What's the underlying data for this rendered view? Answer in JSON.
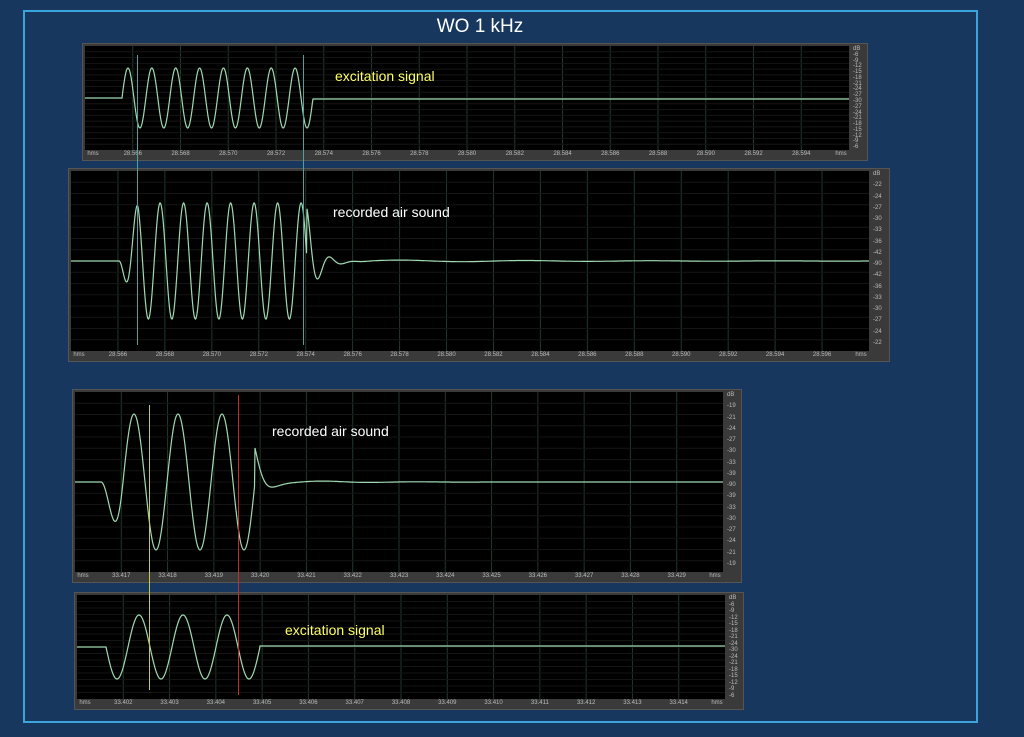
{
  "title": "WO  1 kHz",
  "colors": {
    "background": "#17375e",
    "frame": "#3ba4dc",
    "waveform": "#9fd9b0",
    "excitation_label": "#ffff66",
    "recorded_label": "#ffffff",
    "cursor_green": "#4fa0a0",
    "cursor_yellow": "#c8c84a",
    "cursor_red": "#c03030"
  },
  "panels": [
    {
      "id": "top-excitation",
      "label": "excitation signal",
      "label_color": "#ffff66",
      "y_ticks": [
        "dB",
        "-6",
        "-9",
        "-12",
        "-15",
        "-18",
        "-21",
        "-24",
        "-27",
        "-30",
        "-27",
        "-24",
        "-21",
        "-18",
        "-15",
        "-12",
        "-9",
        "-6"
      ],
      "x_ticks": [
        "hms",
        "28.566",
        "28.568",
        "28.570",
        "28.572",
        "28.574",
        "28.576",
        "28.578",
        "28.580",
        "28.582",
        "28.584",
        "28.586",
        "28.588",
        "28.590",
        "28.592",
        "28.594",
        "hms"
      ]
    },
    {
      "id": "top-recorded",
      "label": "recorded air sound",
      "label_color": "#ffffff",
      "y_ticks": [
        "dB",
        "-22",
        "-24",
        "-27",
        "-30",
        "-33",
        "-36",
        "-42",
        "-90",
        "-42",
        "-36",
        "-33",
        "-30",
        "-27",
        "-24",
        "-22"
      ],
      "x_ticks": [
        "hms",
        "28.566",
        "28.568",
        "28.570",
        "28.572",
        "28.574",
        "28.576",
        "28.578",
        "28.580",
        "28.582",
        "28.584",
        "28.586",
        "28.588",
        "28.590",
        "28.592",
        "28.594",
        "28.596",
        "hms"
      ]
    },
    {
      "id": "bottom-recorded",
      "label": "recorded air sound",
      "label_color": "#ffffff",
      "y_ticks": [
        "dB",
        "-19",
        "-21",
        "-24",
        "-27",
        "-30",
        "-33",
        "-39",
        "-90",
        "-39",
        "-33",
        "-30",
        "-27",
        "-24",
        "-21",
        "-19"
      ],
      "x_ticks": [
        "hms",
        "33.417",
        "33.418",
        "33.419",
        "33.420",
        "33.421",
        "33.422",
        "33.423",
        "33.424",
        "33.425",
        "33.426",
        "33.427",
        "33.428",
        "33.429",
        "hms"
      ]
    },
    {
      "id": "bottom-excitation",
      "label": "excitation signal",
      "label_color": "#ffff66",
      "y_ticks": [
        "dB",
        "-6",
        "-9",
        "-12",
        "-15",
        "-18",
        "-21",
        "-24",
        "-30",
        "-24",
        "-21",
        "-18",
        "-15",
        "-12",
        "-9",
        "-6"
      ],
      "x_ticks": [
        "hms",
        "33.402",
        "33.403",
        "33.404",
        "33.405",
        "33.406",
        "33.407",
        "33.408",
        "33.409",
        "33.410",
        "33.411",
        "33.412",
        "33.413",
        "33.414",
        "hms"
      ]
    }
  ]
}
